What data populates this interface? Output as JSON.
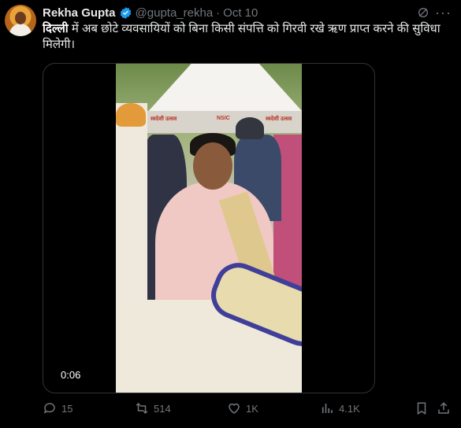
{
  "tweet": {
    "author_name": "Rekha Gupta",
    "handle": "@gupta_rekha",
    "date": "Oct 10",
    "text_highlight": "दिल्ली",
    "text_rest": " में अब छोटे व्यवसायियों को बिना किसी संपत्ति को गिरवी रखे ऋण प्राप्त करने की सुविधा मिलेगी।"
  },
  "media": {
    "timecode": "0:06",
    "banner_text_left": "स्वदेशी उत्सव",
    "banner_text_mid": "NSIC",
    "banner_text_right": "स्वदेशी उत्सव"
  },
  "actions": {
    "replies": "15",
    "reposts": "514",
    "likes": "1K",
    "views": "4.1K"
  },
  "colors": {
    "background": "#000000",
    "text_primary": "#e7e9ea",
    "text_secondary": "#71767b",
    "verified": "#1d9bf0"
  }
}
